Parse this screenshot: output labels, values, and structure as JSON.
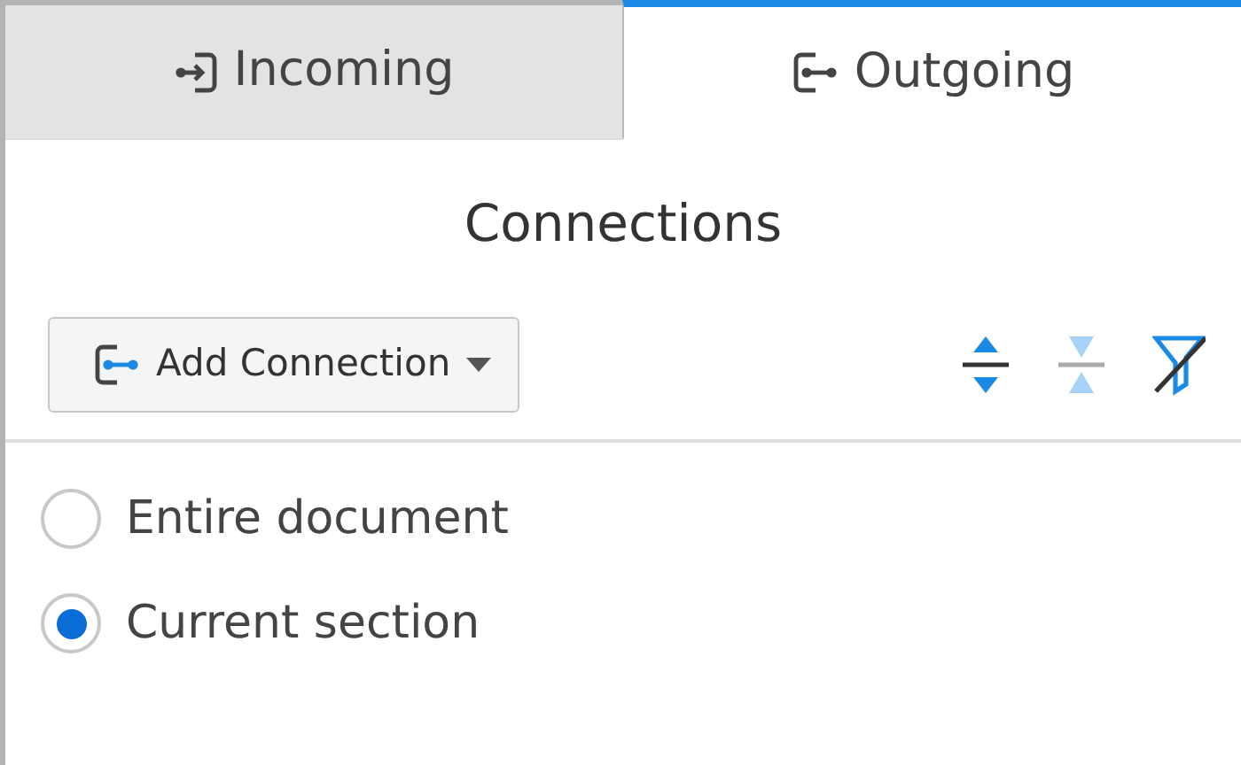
{
  "tabs": [
    {
      "label": "Incoming",
      "kind": "incoming",
      "selected": false
    },
    {
      "label": "Outgoing",
      "kind": "outgoing",
      "selected": true
    }
  ],
  "title": "Connections",
  "add_button": {
    "label": "Add Connection"
  },
  "tools": [
    {
      "kind": "expand",
      "disabled": false
    },
    {
      "kind": "collapse",
      "disabled": true
    },
    {
      "kind": "filter",
      "disabled": false
    }
  ],
  "scope": [
    {
      "label": "Entire document",
      "selected": false
    },
    {
      "label": "Current section",
      "selected": true
    }
  ]
}
